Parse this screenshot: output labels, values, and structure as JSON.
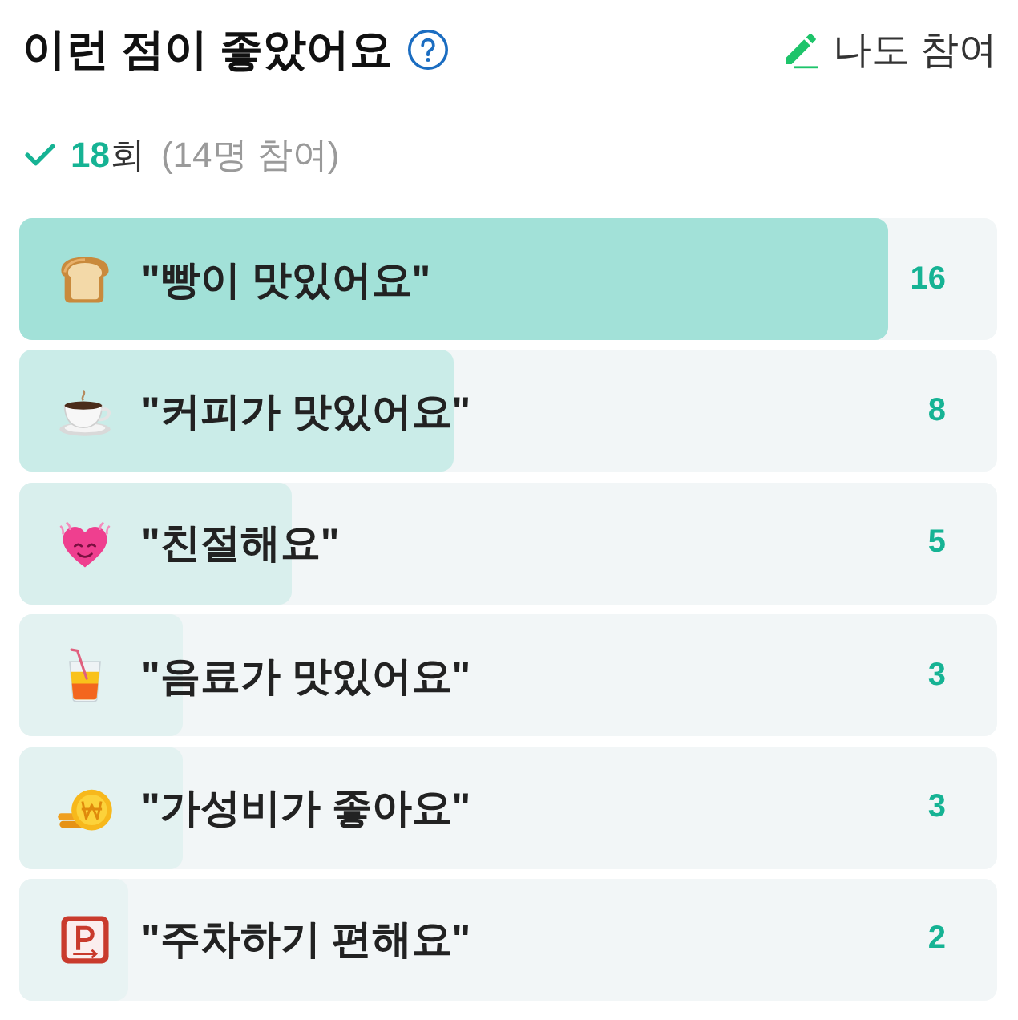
{
  "header": {
    "title": "이런 점이 좋았어요",
    "join_button": "나도 참여"
  },
  "summary": {
    "count": "18",
    "unit": "회",
    "participants": "(14명 참여)"
  },
  "items": [
    {
      "label": "\"빵이 맛있어요\"",
      "count": "16",
      "level": 0.889
    },
    {
      "label": "\"커피가 맛있어요\"",
      "count": "8",
      "level": 0.444
    },
    {
      "label": "\"친절해요\"",
      "count": "5",
      "level": 0.278
    },
    {
      "label": "\"음료가 맛있어요\"",
      "count": "3",
      "level": 0.167
    },
    {
      "label": "\"가성비가 좋아요\"",
      "count": "3",
      "level": 0.167
    },
    {
      "label": "\"주차하기 편해요\"",
      "count": "2",
      "level": 0.111
    }
  ]
}
